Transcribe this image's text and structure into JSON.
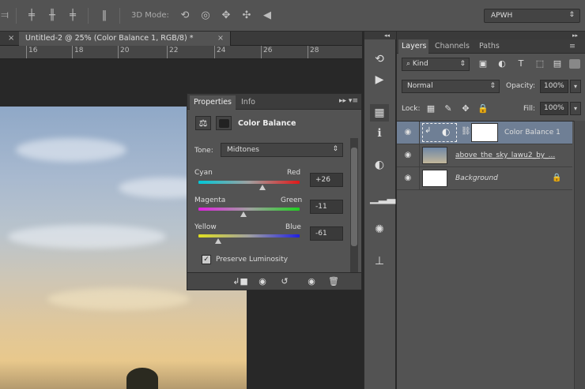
{
  "toolbar": {
    "mode_3d_label": "3D Mode:",
    "workspace": "APWH"
  },
  "document": {
    "tab_title": "Untitled-2 @ 25% (Color Balance 1, RGB/8) *",
    "ruler_marks": [
      "16",
      "18",
      "20",
      "22",
      "24",
      "26",
      "28"
    ]
  },
  "properties": {
    "tab_properties": "Properties",
    "tab_info": "Info",
    "adjustment_title": "Color Balance",
    "tone_label": "Tone:",
    "tone_value": "Midtones",
    "sliders": [
      {
        "left": "Cyan",
        "right": "Red",
        "value": "+26",
        "numeric": 26
      },
      {
        "left": "Magenta",
        "right": "Green",
        "value": "-11",
        "numeric": -11
      },
      {
        "left": "Yellow",
        "right": "Blue",
        "value": "-61",
        "numeric": -61
      }
    ],
    "preserve_luminosity_label": "Preserve Luminosity",
    "preserve_luminosity_checked": true
  },
  "layers": {
    "tab_layers": "Layers",
    "tab_channels": "Channels",
    "tab_paths": "Paths",
    "kind_label": "Kind",
    "blend_mode": "Normal",
    "opacity_label": "Opacity:",
    "opacity_value": "100%",
    "lock_label": "Lock:",
    "fill_label": "Fill:",
    "fill_value": "100%",
    "items": [
      {
        "name": "Color Balance 1",
        "selected": true
      },
      {
        "name": "above_the_sky_lawu2_by_...",
        "selected": false
      },
      {
        "name": "Background",
        "selected": false
      }
    ]
  },
  "colors": {
    "panel_bg": "#535353",
    "selected_layer": "#6f7f95",
    "app_bg": "#282828"
  }
}
